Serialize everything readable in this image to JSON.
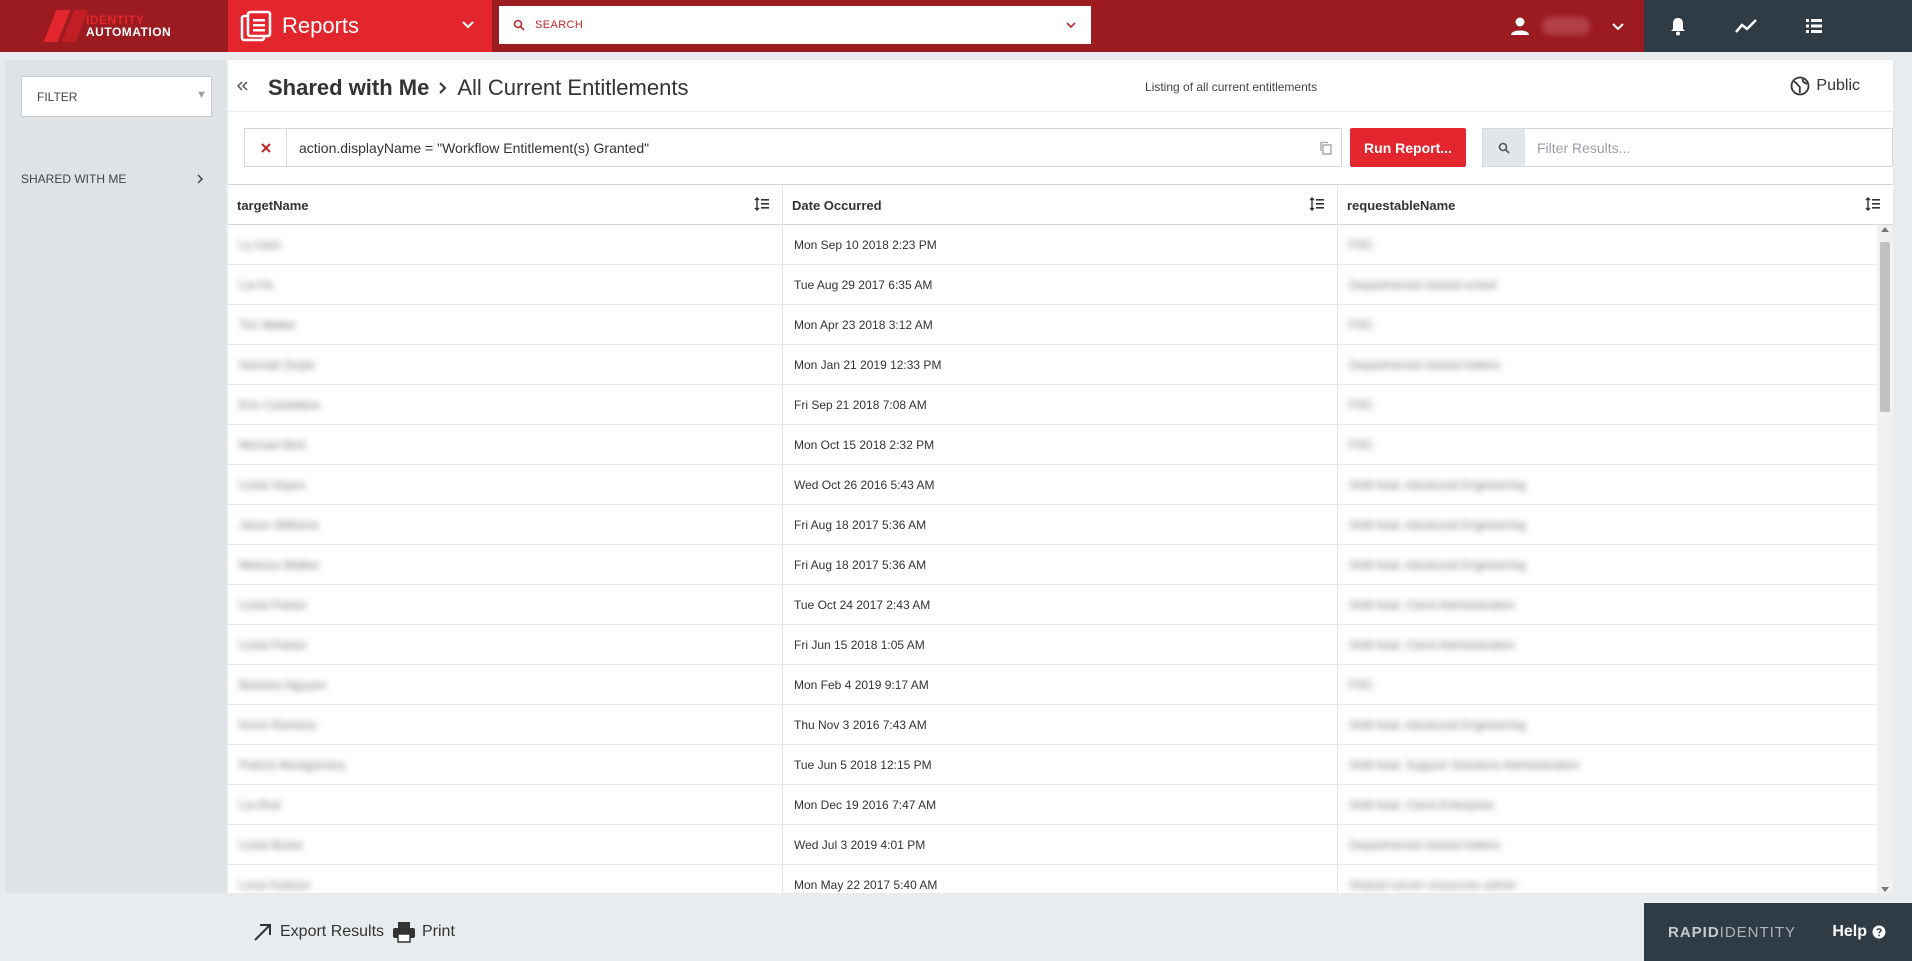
{
  "brand": {
    "logo_line1": "IDENTITY",
    "logo_line2": "AUTOMATION",
    "footer_rapid": "RAPID",
    "footer_identity": "IDENTITY"
  },
  "module": {
    "title": "Reports"
  },
  "search": {
    "placeholder": "SEARCH"
  },
  "sidebar": {
    "filter_label": "FILTER",
    "items": [
      {
        "label": "SHARED WITH ME"
      }
    ]
  },
  "page": {
    "breadcrumb_parent": "Shared with Me",
    "breadcrumb_current": "All Current Entitlements",
    "description": "Listing of all current entitlements",
    "visibility": "Public"
  },
  "query": {
    "expression": "action.displayName = \"Workflow Entitlement(s) Granted\"",
    "run_label": "Run Report...",
    "filter_placeholder": "Filter Results..."
  },
  "table": {
    "columns": [
      "targetName",
      "Date Occurred",
      "requestableName"
    ],
    "rows": [
      {
        "target": "Lu Irwin",
        "date": "Mon Sep 10 2018 2:23 PM",
        "requestable": "PSC"
      },
      {
        "target": "Lia Ho",
        "date": "Tue Aug 29 2017 6:35 AM",
        "requestable": "Departmental shared sched"
      },
      {
        "target": "Tim Walter",
        "date": "Mon Apr 23 2018 3:12 AM",
        "requestable": "PSC"
      },
      {
        "target": "Hannah Doyle",
        "date": "Mon Jan 21 2019 12:33 PM",
        "requestable": "Departmental shared folders"
      },
      {
        "target": "Erin Castellano",
        "date": "Fri Sep 21 2018 7:08 AM",
        "requestable": "PSC"
      },
      {
        "target": "Michael Bird",
        "date": "Mon Oct 15 2018 2:32 PM",
        "requestable": "PSC"
      },
      {
        "target": "Linda Hayes",
        "date": "Wed Oct 26 2016 5:43 AM",
        "requestable": "Shift lead, Advanced Engineering"
      },
      {
        "target": "Jason Williams",
        "date": "Fri Aug 18 2017 5:36 AM",
        "requestable": "Shift lead, Advanced Engineering"
      },
      {
        "target": "Melissa Walker",
        "date": "Fri Aug 18 2017 5:36 AM",
        "requestable": "Shift lead, Advanced Engineering"
      },
      {
        "target": "Linda Parker",
        "date": "Tue Oct 24 2017 2:43 AM",
        "requestable": "Shift lead, Client Administration"
      },
      {
        "target": "Linda Parker",
        "date": "Fri Jun 15 2018 1:05 AM",
        "requestable": "Shift lead, Client Administration"
      },
      {
        "target": "Barbara Nguyen",
        "date": "Mon Feb 4 2019 9:17 AM",
        "requestable": "PSC"
      },
      {
        "target": "Kevin Ramirez",
        "date": "Thu Nov 3 2016 7:43 AM",
        "requestable": "Shift lead, Advanced Engineering"
      },
      {
        "target": "Patrick Montgomery",
        "date": "Tue Jun 5 2018 12:15 PM",
        "requestable": "Shift lead, Support Solutions Administration"
      },
      {
        "target": "Lia Rod",
        "date": "Mon Dec 19 2016 7:47 AM",
        "requestable": "Shift lead, Client Enterprise"
      },
      {
        "target": "Linda Burke",
        "date": "Wed Jul 3 2019 4:01 PM",
        "requestable": "Departmental shared folders"
      },
      {
        "target": "Lena Hudson",
        "date": "Mon May 22 2017 5:40 AM",
        "requestable": "Shared server resources admin"
      }
    ]
  },
  "footer": {
    "export_label": "Export Results",
    "print_label": "Print",
    "help_label": "Help"
  },
  "colors": {
    "topbar": "#9b1b20",
    "accent": "#e3262d",
    "dark": "#2f3b45"
  }
}
